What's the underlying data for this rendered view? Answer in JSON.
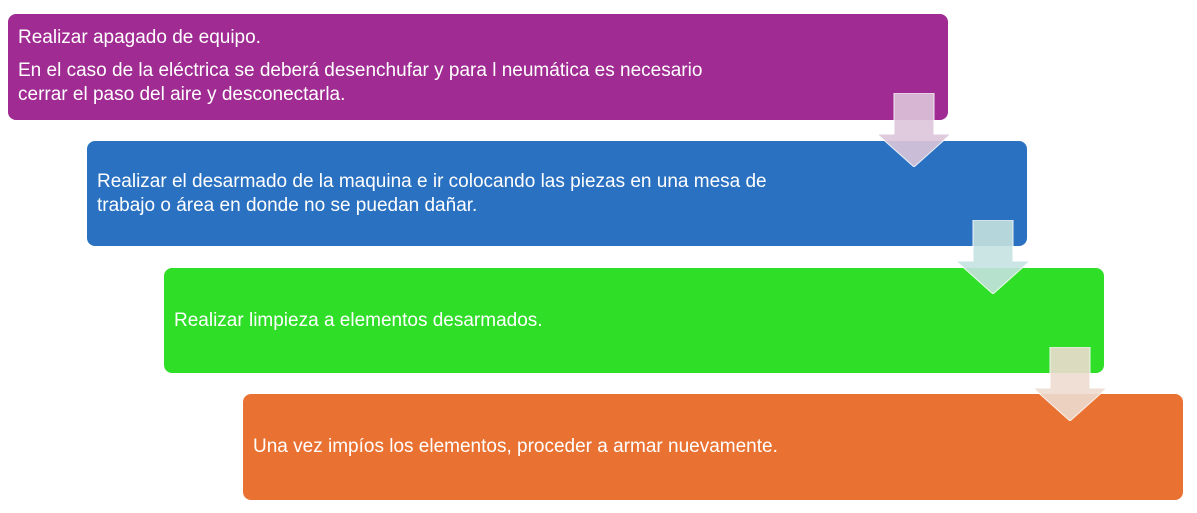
{
  "steps": [
    {
      "lines": [
        "Realizar apagado de equipo.",
        "En el caso de la eléctrica se deberá desenchufar y para l  neumática es necesario",
        "cerrar el paso del aire y desconectarla."
      ],
      "color": "#A02B93"
    },
    {
      "lines": [
        "Realizar el desarmado de la maquina e ir colocando las piezas en una mesa de",
        "trabajo o área en donde no se puedan dañar."
      ],
      "color": "#2A71C1"
    },
    {
      "lines": [
        "Realizar limpieza a elementos desarmados."
      ],
      "color": "#2FDE27"
    },
    {
      "lines": [
        "Una vez impíos los elementos, proceder a armar nuevamente."
      ],
      "color": "#E97132"
    }
  ],
  "arrows": [
    {
      "icon": "down-arrow-icon",
      "color": "#DCC6DA"
    },
    {
      "icon": "down-arrow-icon",
      "color": "#C5E3E0"
    },
    {
      "icon": "down-arrow-icon",
      "color": "#EEDCD0"
    }
  ]
}
